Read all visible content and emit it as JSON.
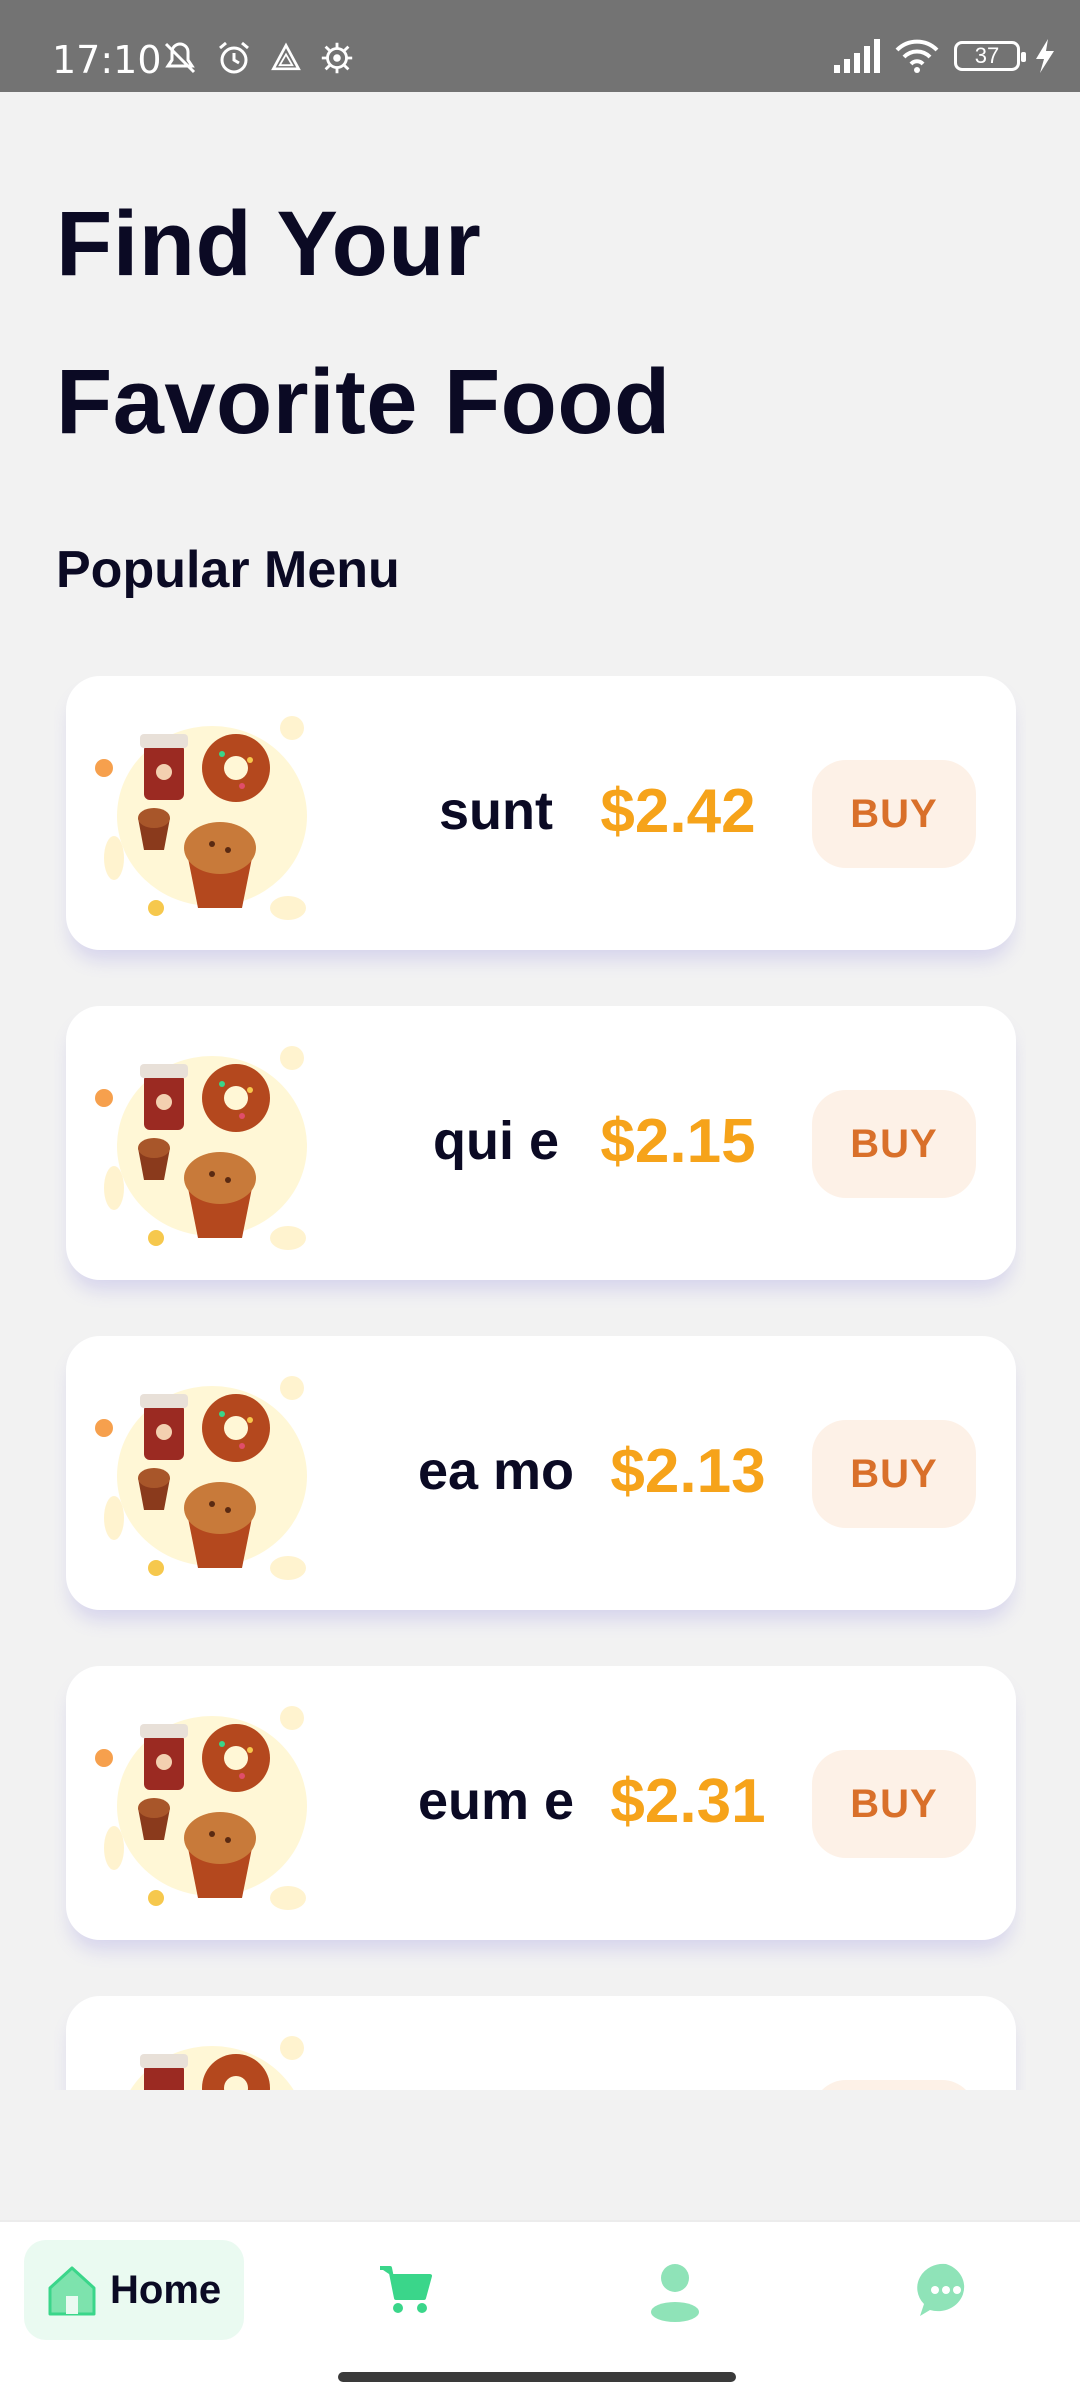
{
  "status_bar": {
    "time": "17:10",
    "battery": "37",
    "left_icons": [
      "mute-icon",
      "alarm-icon",
      "drive-icon",
      "settings-icon"
    ],
    "right_icons": [
      "signal-icon",
      "wifi-icon",
      "battery-icon",
      "charging-icon"
    ]
  },
  "header": {
    "line1": "Find Your",
    "line2": "Favorite Food"
  },
  "section_title": "Popular Menu",
  "menu": [
    {
      "name": "sunt",
      "price": "$2.42",
      "buy": "BUY"
    },
    {
      "name": "qui e",
      "price": "$2.15",
      "buy": "BUY"
    },
    {
      "name": "ea mo",
      "price": "$2.13",
      "buy": "BUY"
    },
    {
      "name": "eum e",
      "price": "$2.31",
      "buy": "BUY"
    },
    {
      "name": "",
      "price": "",
      "buy": ""
    }
  ],
  "nav": {
    "home_label": "Home",
    "items": [
      "home-icon",
      "cart-icon",
      "profile-icon",
      "chat-icon"
    ]
  },
  "colors": {
    "accent_green": "#3ad68a",
    "price_orange": "#f6a31a",
    "buy_text": "#d9702a",
    "heading": "#0b0a24"
  }
}
